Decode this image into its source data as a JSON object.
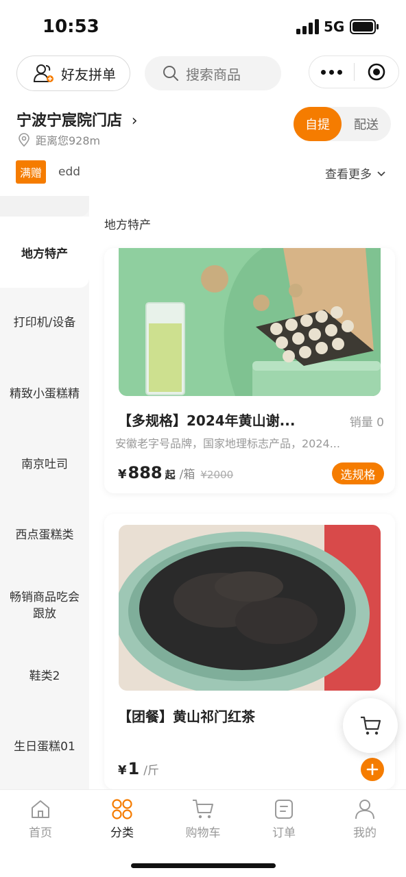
{
  "status_bar": {
    "time": "10:53",
    "network": "5G"
  },
  "header": {
    "friend_group_label": "好友拼单",
    "search_placeholder": "搜索商品"
  },
  "store": {
    "name": "宁波宁宸院门店",
    "distance": "距离您928m",
    "mode_pickup": "自提",
    "mode_delivery": "配送"
  },
  "promo": {
    "badge": "满赠",
    "text": "edd",
    "see_more": "查看更多"
  },
  "sidebar": {
    "active": "地方特产",
    "items": [
      "打印机/设备",
      "精致小蛋糕精",
      "南京吐司",
      "西点蛋糕类",
      "畅销商品吃会跟放",
      "鞋类2",
      "生日蛋糕01"
    ]
  },
  "section_title": "地方特产",
  "products": [
    {
      "title": "【多规格】2024年黄山谢...",
      "sales": "销量 0",
      "desc": "安徽老字号品牌，国家地理标志产品，2024...",
      "currency": "¥",
      "price": "888",
      "from": "起",
      "unit": "/箱",
      "original_price": "¥2000",
      "action": "选规格"
    },
    {
      "title": "【团餐】黄山祁门红茶",
      "currency": "¥",
      "price": "1",
      "unit": "/斤"
    }
  ],
  "tabbar": {
    "items": [
      {
        "label": "首页",
        "icon": "home-icon"
      },
      {
        "label": "分类",
        "icon": "category-icon"
      },
      {
        "label": "购物车",
        "icon": "cart-icon"
      },
      {
        "label": "订单",
        "icon": "order-icon"
      },
      {
        "label": "我的",
        "icon": "profile-icon"
      }
    ],
    "active_index": 1
  },
  "colors": {
    "accent": "#f57c00",
    "text": "#222222",
    "muted": "#999999",
    "sidebar_bg": "#f6f6f6"
  }
}
